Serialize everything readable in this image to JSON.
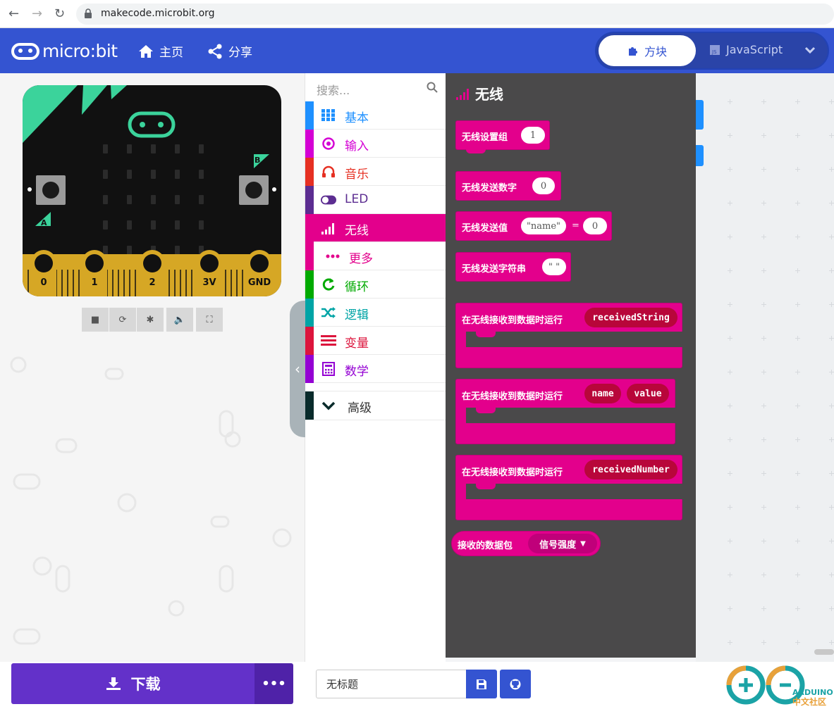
{
  "browser": {
    "url": "makecode.microbit.org"
  },
  "header": {
    "brand": "micro:bit",
    "home_label": "主页",
    "share_label": "分享",
    "blocks_label": "方块",
    "js_label": "JavaScript",
    "accent": "#3454d1"
  },
  "simulator": {
    "pin_labels": [
      "0",
      "1",
      "2",
      "3V",
      "GND"
    ],
    "button_a": "A",
    "button_b": "B",
    "controls": [
      "stop-icon",
      "restart-icon",
      "debug-icon",
      "sound-icon",
      "fullscreen-icon"
    ]
  },
  "toolbox": {
    "search_placeholder": "搜索...",
    "categories": [
      {
        "label": "基本",
        "color": "#1e90ff",
        "icon": "grid-icon"
      },
      {
        "label": "输入",
        "color": "#d400d4",
        "icon": "target-icon"
      },
      {
        "label": "音乐",
        "color": "#e63022",
        "icon": "headphones-icon"
      },
      {
        "label": "LED",
        "color": "#5c2d91",
        "icon": "toggle-icon"
      },
      {
        "label": "无线",
        "color": "#e3008c",
        "icon": "signal-icon"
      },
      {
        "label": "更多",
        "color": "#e3008c",
        "icon": "dots-icon"
      },
      {
        "label": "循环",
        "color": "#00aa00",
        "icon": "refresh-icon"
      },
      {
        "label": "逻辑",
        "color": "#00a4a6",
        "icon": "shuffle-icon"
      },
      {
        "label": "变量",
        "color": "#dc143c",
        "icon": "list-icon"
      },
      {
        "label": "数学",
        "color": "#9400d3",
        "icon": "calculator-icon"
      },
      {
        "label": "高级",
        "color": "#092b2b",
        "icon": "chevron-down-icon"
      }
    ]
  },
  "flyout": {
    "title": "无线",
    "color": "#e3008c",
    "blocks": {
      "set_group": "无线设置组",
      "set_group_value": "1",
      "send_number": "无线发送数字",
      "send_number_value": "0",
      "send_value": "无线发送值",
      "send_value_name": "\"name\"",
      "send_value_eq": "=",
      "send_value_value": "0",
      "send_string": "无线发送字符串",
      "send_string_value": "\" \"",
      "on_receive_string": "在无线接收到数据时运行",
      "received_string_var": "receivedString",
      "on_receive_value": "在无线接收到数据时运行",
      "name_var": "name",
      "value_var": "value",
      "on_receive_number": "在无线接收到数据时运行",
      "received_number_var": "receivedNumber",
      "packet": "接收的数据包",
      "packet_dropdown": "信号强度"
    }
  },
  "bottom": {
    "download_label": "下载",
    "more_label": "•••",
    "project_name": "无标题",
    "watermark_text": "ARDUINO",
    "watermark_sub": "中文社区"
  }
}
